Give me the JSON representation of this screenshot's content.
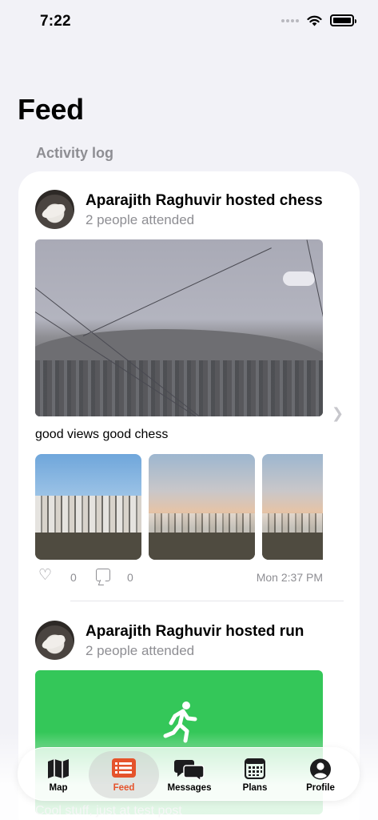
{
  "status_bar": {
    "time": "7:22"
  },
  "header": {
    "title": "Feed",
    "section_label": "Activity log"
  },
  "posts": [
    {
      "title": "Aparajith Raghuvir hosted chess",
      "subtitle": "2 people attended",
      "caption": "good views good chess",
      "likes": "0",
      "comments": "0",
      "timestamp": "Mon 2:37 PM"
    },
    {
      "title": "Aparajith Raghuvir hosted run",
      "subtitle": "2 people attended",
      "caption": "Cool stuff, just at test post"
    }
  ],
  "tabs": [
    {
      "label": "Map",
      "icon": "map-icon"
    },
    {
      "label": "Feed",
      "icon": "feed-icon",
      "selected": true
    },
    {
      "label": "Messages",
      "icon": "messages-icon"
    },
    {
      "label": "Plans",
      "icon": "calendar-icon"
    },
    {
      "label": "Profile",
      "icon": "person-icon"
    }
  ],
  "colors": {
    "accent": "#e5532b",
    "run_banner": "#34c759",
    "background": "#f2f2f7"
  }
}
